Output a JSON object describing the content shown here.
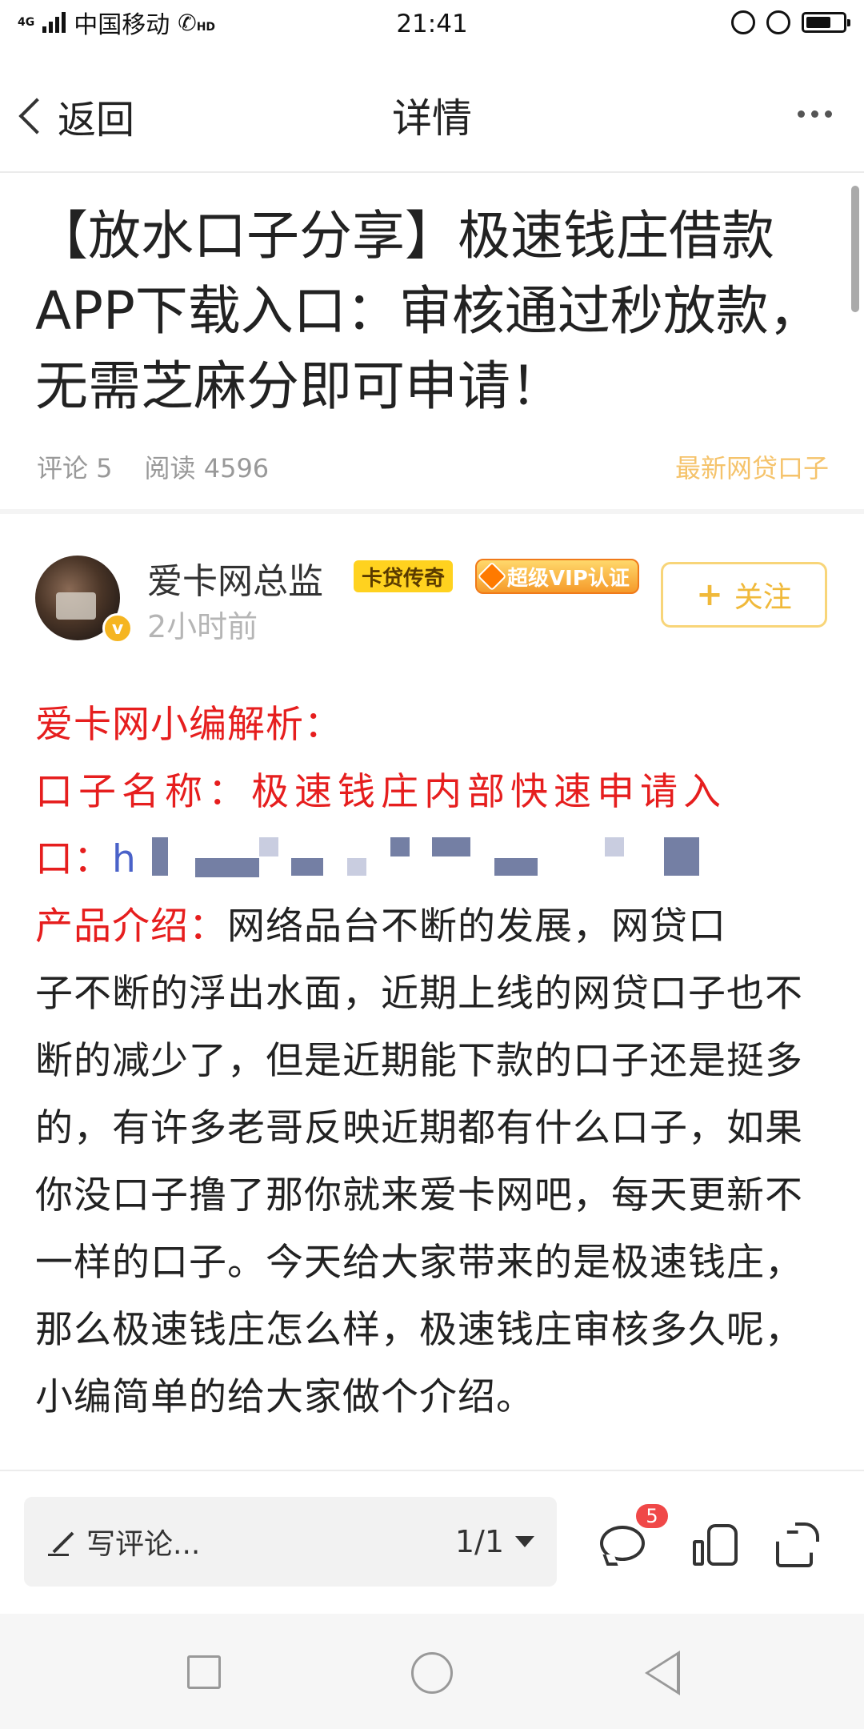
{
  "status_bar": {
    "carrier": "中国移动",
    "network": "4G",
    "hd": "HD",
    "time": "21:41"
  },
  "nav": {
    "back_label": "返回",
    "title": "详情"
  },
  "article": {
    "title": "【放水口子分享】极速钱庄借款APP下载入口：审核通过秒放款，无需芝麻分即可申请！",
    "comments_label": "评论 5",
    "reads_label": "阅读 4596",
    "tag": "最新网贷口子"
  },
  "author": {
    "name": "爱卡网总监",
    "level_badge": "卡贷传奇",
    "vip_badge": "超级VIP认证",
    "time_ago": "2小时前",
    "follow_label": "关注",
    "verified_mark": "v"
  },
  "body": {
    "heading": "爱卡网小编解析：",
    "name_label": "口子名称：",
    "name_value": "极速钱庄内部快速申请入",
    "entry_label": "口：",
    "link_start": "h",
    "intro_label": "产品介绍：",
    "intro_text_1": "网络品台不断的发展，网贷口",
    "intro_text_2": "子不断的浮出水面，近期上线的网贷口子也不断的减少了，但是近期能下款的口子还是挺多的，有许多老哥反映近期都有什么口子，如果你没口子撸了那你就来爱卡网吧，每天更新不一样的口子。今天给大家带来的是极速钱庄，那么极速钱庄怎么样，极速钱庄审核多久呢，小编简单的给大家做个介绍。"
  },
  "toolbar": {
    "comment_placeholder": "写评论...",
    "page_indicator": "1/1",
    "comment_count": "5"
  },
  "colors": {
    "accent_red": "#e61e1e",
    "follow_yellow": "#f0b93a",
    "tag_yellow": "#f5c36b",
    "badge_red": "#f04848"
  }
}
